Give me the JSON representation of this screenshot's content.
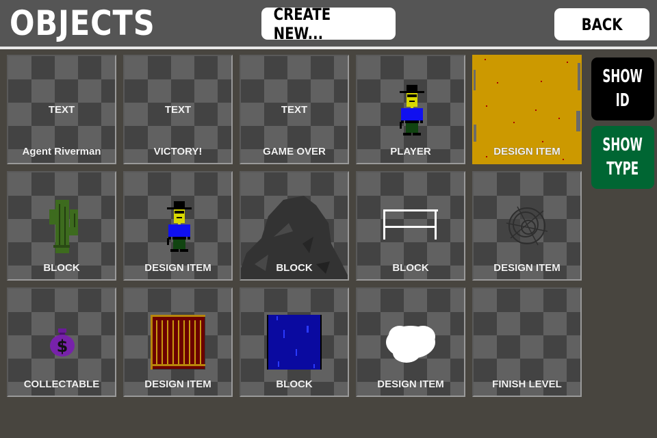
{
  "header": {
    "title": "OBJECTS",
    "create_label": "CREATE NEW...",
    "back_label": "BACK"
  },
  "side": {
    "show_id_label_1": "SHOW",
    "show_id_label_2": "ID",
    "show_type_label_1": "SHOW",
    "show_type_label_2": "TYPE"
  },
  "colors": {
    "show_id_bg": "#000000",
    "show_type_bg": "#006633",
    "checker_light": "#616161",
    "checker_dark": "#434343"
  },
  "objects": [
    {
      "type": "TEXT",
      "label": "Agent Riverman",
      "icon": "text-object"
    },
    {
      "type": "TEXT",
      "label": "VICTORY!",
      "icon": "text-object"
    },
    {
      "type": "TEXT",
      "label": "GAME OVER",
      "icon": "text-object"
    },
    {
      "label": "PLAYER",
      "icon": "cowboy-icon"
    },
    {
      "label": "DESIGN ITEM",
      "icon": "desert-sand-icon"
    },
    {
      "label": "BLOCK",
      "icon": "cactus-icon"
    },
    {
      "label": "DESIGN ITEM",
      "icon": "cowboy-icon"
    },
    {
      "label": "BLOCK",
      "icon": "rock-pile-icon"
    },
    {
      "label": "BLOCK",
      "icon": "fence-icon"
    },
    {
      "label": "DESIGN ITEM",
      "icon": "tumbleweed-icon"
    },
    {
      "label": "COLLECTABLE",
      "icon": "money-bag-icon"
    },
    {
      "label": "DESIGN ITEM",
      "icon": "wooden-crate-icon"
    },
    {
      "label": "BLOCK",
      "icon": "water-block-icon"
    },
    {
      "label": "DESIGN ITEM",
      "icon": "cloud-icon"
    },
    {
      "label": "FINISH LEVEL",
      "icon": "none"
    }
  ]
}
